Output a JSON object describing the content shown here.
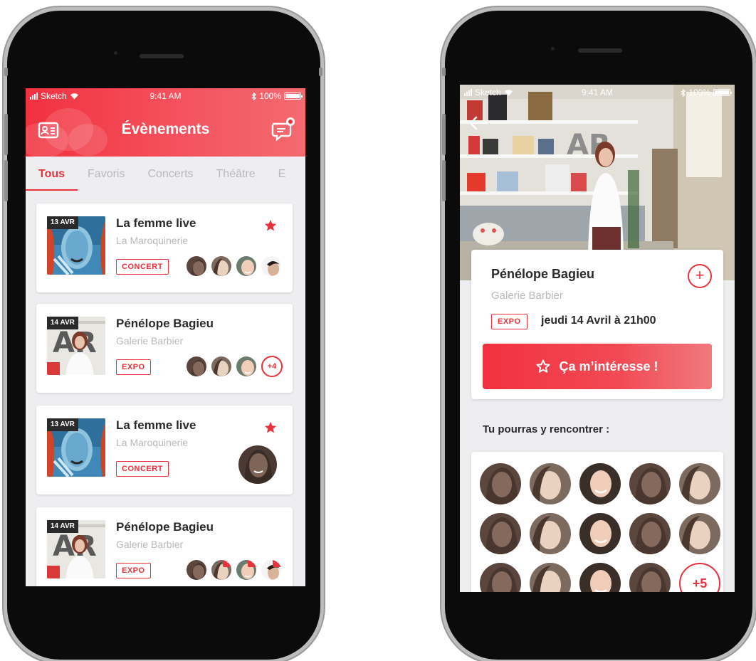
{
  "status_bar": {
    "carrier": "Sketch",
    "time": "9:41 AM",
    "battery": "100%"
  },
  "left_screen": {
    "title": "Évènements",
    "tabs": [
      "Tous",
      "Favoris",
      "Concerts",
      "Théâtre",
      "E"
    ],
    "events": [
      {
        "date": "13 AVR",
        "title": "La femme live",
        "venue": "La Maroquinerie",
        "tag": "CONCERT",
        "favorite": true
      },
      {
        "date": "14 AVR",
        "title": "Pénélope Bagieu",
        "venue": "Galerie Barbier",
        "tag": "EXPO",
        "favorite": false,
        "more": "+4"
      },
      {
        "date": "13 AVR",
        "title": "La femme live",
        "venue": "La Maroquinerie",
        "tag": "CONCERT",
        "favorite": true
      },
      {
        "date": "14 AVR",
        "title": "Pénélope Bagieu",
        "venue": "Galerie Barbier",
        "tag": "EXPO",
        "favorite": false,
        "add_badge": "+"
      }
    ]
  },
  "right_screen": {
    "title": "Pénélope Bagieu",
    "venue": "Galerie Barbier",
    "tag": "EXPO",
    "date": "jeudi 14 Avril à 21h00",
    "plus": "+",
    "cta": "Ça m’intéresse !",
    "meet_title": "Tu pourras y rencontrer :",
    "more_count": "+5"
  },
  "colors": {
    "accent": "#e8323c",
    "dark": "#2a2a2c",
    "muted": "#b9b9bd"
  }
}
